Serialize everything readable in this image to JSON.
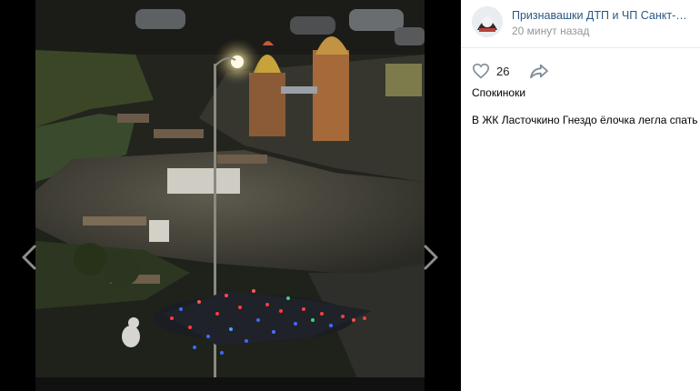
{
  "photo": {
    "description_icon": "photo-night-playground"
  },
  "navigation": {
    "prev_icon": "chevron-left-icon",
    "next_icon": "chevron-right-icon"
  },
  "post": {
    "group_name": "Признавашки ДТП и ЧП Санкт-Петербург",
    "time": "20 минут назад",
    "likes": "26",
    "author": "Спокиноки",
    "text": "В ЖК Ласточкино Гнездо ёлочка легла спать"
  },
  "colors": {
    "link": "#2a5885",
    "muted": "#939699",
    "divider": "#e7e8ec"
  }
}
